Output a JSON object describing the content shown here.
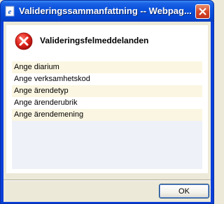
{
  "window": {
    "title": "Valideringssammanfattning -- Webpag..."
  },
  "icons": {
    "app_icon": "ie-page-icon",
    "close": "close-icon",
    "status": "error-icon"
  },
  "colors": {
    "title_bar": "#0a52dc",
    "error_red": "#d6221c",
    "row_highlight": "#fbf6e1"
  },
  "panel": {
    "header": "Valideringsfelmeddelanden",
    "messages": [
      "Ange diarium",
      "Ange verksamhetskod",
      "Ange ärendetyp",
      "Ange ärenderubrik",
      "Ange ärendemening"
    ]
  },
  "footer": {
    "ok_label": "OK"
  }
}
